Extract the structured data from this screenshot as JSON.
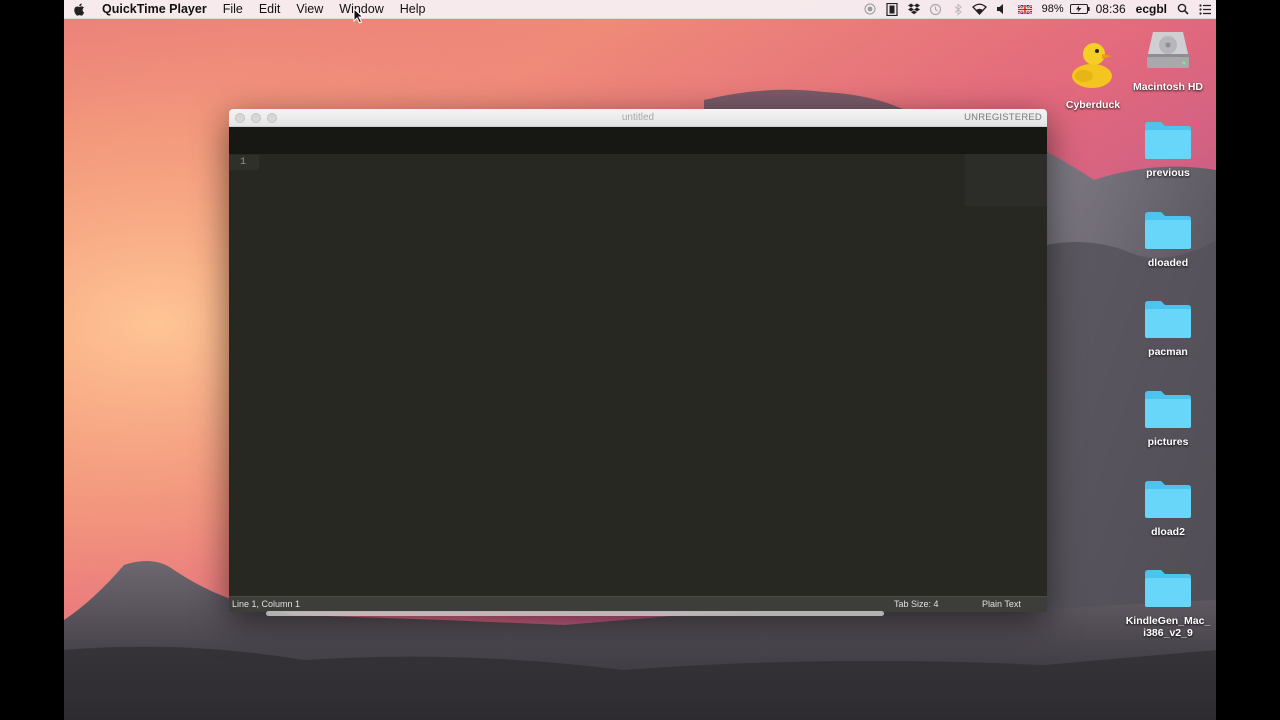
{
  "menubar": {
    "app_name": "QuickTime Player",
    "menus": [
      "File",
      "Edit",
      "View",
      "Window",
      "Help"
    ],
    "battery": "98%",
    "time": "08:36",
    "user": "ecgbl"
  },
  "desktop": {
    "icons": [
      {
        "label": "Cyberduck",
        "icon": "cyberduck-icon"
      },
      {
        "label": "Macintosh HD",
        "icon": "hard-drive-icon"
      },
      {
        "label": "previous",
        "icon": "folder-icon"
      },
      {
        "label": "dloaded",
        "icon": "folder-icon"
      },
      {
        "label": "pacman",
        "icon": "folder-icon"
      },
      {
        "label": "pictures",
        "icon": "folder-icon"
      },
      {
        "label": "dload2",
        "icon": "folder-icon"
      },
      {
        "label": "KindleGen_Mac_\ni386_v2_9",
        "icon": "folder-icon"
      }
    ]
  },
  "window": {
    "title": "untitled",
    "license": "UNREGISTERED",
    "line_number": "1",
    "status": {
      "position": "Line 1, Column 1",
      "tab_size": "Tab Size: 4",
      "syntax": "Plain Text"
    }
  },
  "colors": {
    "editor_bg": "#272822",
    "folder": "#5fd3f6",
    "menubar": "#f6f0f4"
  }
}
